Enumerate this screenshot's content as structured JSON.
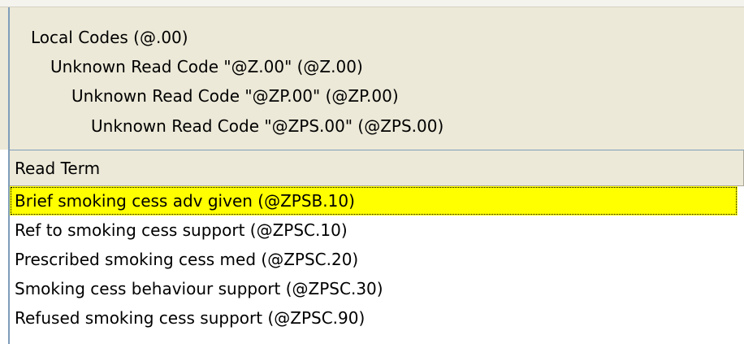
{
  "hierarchy": {
    "lines": [
      "Local Codes (@.00)",
      "Unknown Read Code \"@Z.00\" (@Z.00)",
      "Unknown Read Code \"@ZP.00\" (@ZP.00)",
      "Unknown Read Code \"@ZPS.00\" (@ZPS.00)"
    ]
  },
  "list": {
    "column_header": "Read Term",
    "selected_index": 0,
    "highlight_color": "#ffff00",
    "rows": [
      "Brief smoking cess adv given (@ZPSB.10)",
      "Ref to smoking cess support (@ZPSC.10)",
      "Prescribed smoking cess med (@ZPSC.20)",
      "Smoking cess behaviour support (@ZPSC.30)",
      "Refused smoking cess support (@ZPSC.90)"
    ]
  }
}
